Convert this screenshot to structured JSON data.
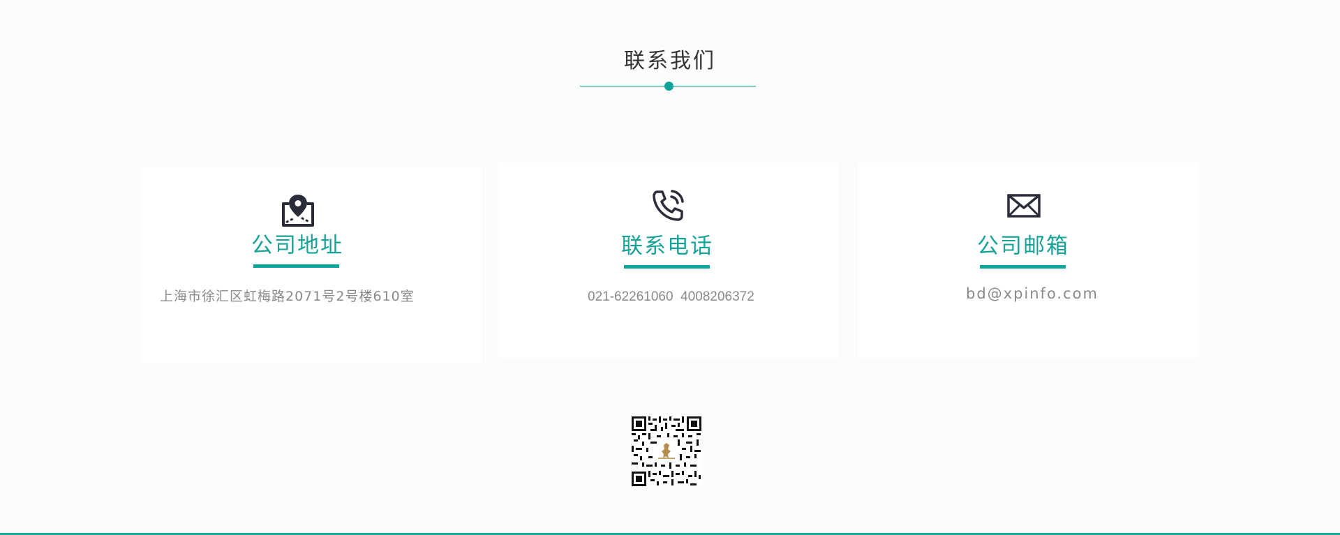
{
  "section": {
    "title": "联系我们"
  },
  "cards": [
    {
      "icon": "map-location-icon",
      "title": "公司地址",
      "text": "上海市徐汇区虹梅路2071号2号楼610室"
    },
    {
      "icon": "phone-icon",
      "title": "联系电话",
      "text": "021-62261060  4008206372"
    },
    {
      "icon": "mail-icon",
      "title": "公司邮箱",
      "text": "bd@xpinfo.com"
    }
  ],
  "qr": {
    "icon": "qr-code-icon"
  },
  "colors": {
    "accent": "#0fa59a",
    "title_text": "#333333",
    "body_text": "#8a8a8a",
    "background": "#fcfcfc",
    "card": "#ffffff",
    "icon": "#2a2c3a"
  }
}
